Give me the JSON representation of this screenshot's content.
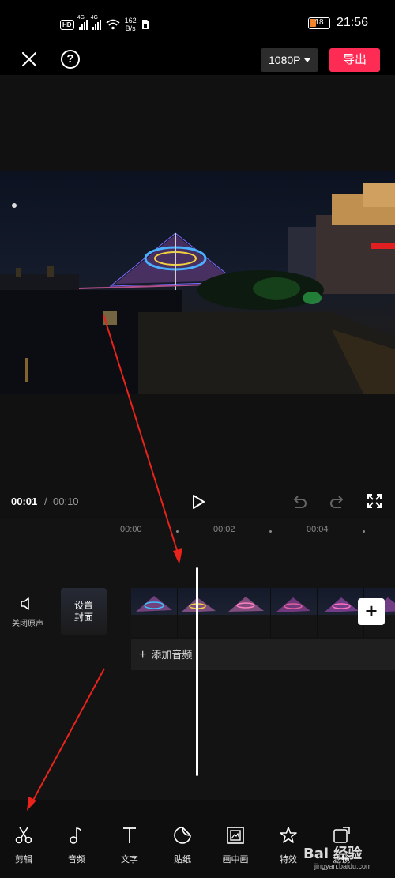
{
  "status_bar": {
    "hd": "HD",
    "sim1": "4G",
    "sim2": "4G",
    "net_speed_value": "162",
    "net_speed_unit": "B/s",
    "battery": "18",
    "time": "21:56"
  },
  "top_bar": {
    "close_icon": "close-icon",
    "help_label": "?",
    "resolution": "1080P",
    "export_label": "导出"
  },
  "player": {
    "current_time": "00:01",
    "separator": "/",
    "total_time": "00:10"
  },
  "timeline": {
    "ruler": [
      "00:00",
      "00:02",
      "00:04"
    ],
    "mute_label": "关闭原声",
    "cover_label": "设置封面",
    "add_clip": "+",
    "add_audio_icon": "+",
    "add_audio_label": "添加音频"
  },
  "toolbar": {
    "items": [
      {
        "icon": "scissors-icon",
        "label": "剪辑"
      },
      {
        "icon": "music-note-icon",
        "label": "音频"
      },
      {
        "icon": "text-icon",
        "label": "文字"
      },
      {
        "icon": "sticker-icon",
        "label": "贴纸"
      },
      {
        "icon": "picture-in-picture-icon",
        "label": "画中画"
      },
      {
        "icon": "effects-star-icon",
        "label": "特效"
      },
      {
        "icon": "filter-icon",
        "label": "滤镜"
      }
    ]
  },
  "watermark": {
    "text": "Bai 经验",
    "sub": "jingyan.baidu.com"
  },
  "colors": {
    "accent": "#fe2c55",
    "annotation_arrow": "#e8231b",
    "battery_low": "#f2852b"
  }
}
